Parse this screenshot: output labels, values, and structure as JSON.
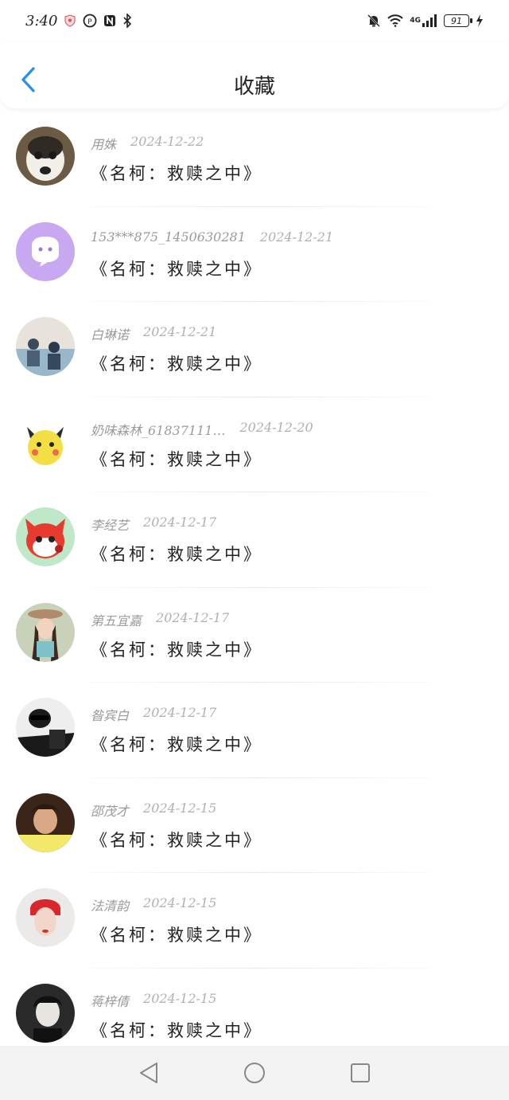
{
  "status_bar": {
    "time": "3:40",
    "battery": "91",
    "network": "4G"
  },
  "header": {
    "title": "收藏",
    "accent_color": "#2a8ee8"
  },
  "items": [
    {
      "user": "用姝",
      "date": "2024-12-22",
      "book": "《名柯：救赎之中》",
      "avatar_color": "#6b5a44"
    },
    {
      "user": "153***875_1450630281",
      "date": "2024-12-21",
      "book": "《名柯：救赎之中》",
      "avatar_color": "#c8a8f0"
    },
    {
      "user": "白琳诺",
      "date": "2024-12-21",
      "book": "《名柯：救赎之中》",
      "avatar_color": "#9ab7c9"
    },
    {
      "user": "奶味森林_61837111…",
      "date": "2024-12-20",
      "book": "《名柯：救赎之中》",
      "avatar_color": "#f3df44"
    },
    {
      "user": "李经艺",
      "date": "2024-12-17",
      "book": "《名柯：救赎之中》",
      "avatar_color": "#e63b2e"
    },
    {
      "user": "第五宜嘉",
      "date": "2024-12-17",
      "book": "《名柯：救赎之中》",
      "avatar_color": "#a8b89a"
    },
    {
      "user": "昝宾白",
      "date": "2024-12-17",
      "book": "《名柯：救赎之中》",
      "avatar_color": "#2b2b2b"
    },
    {
      "user": "邵茂才",
      "date": "2024-12-15",
      "book": "《名柯：救赎之中》",
      "avatar_color": "#7a4a2a"
    },
    {
      "user": "法清韵",
      "date": "2024-12-15",
      "book": "《名柯：救赎之中》",
      "avatar_color": "#d9d2cf"
    },
    {
      "user": "蒋梓倩",
      "date": "2024-12-15",
      "book": "《名柯：救赎之中》",
      "avatar_color": "#333333"
    }
  ]
}
